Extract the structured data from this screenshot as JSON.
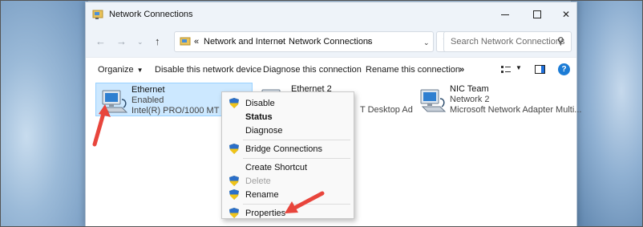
{
  "window": {
    "title": "Network Connections"
  },
  "address": {
    "prefix": "«",
    "crumbs": [
      "Network and Internet",
      "Network Connections"
    ]
  },
  "search": {
    "placeholder": "Search Network Connections"
  },
  "toolbar": {
    "organize": "Organize",
    "disable": "Disable this network device",
    "diagnose": "Diagnose this connection",
    "rename": "Rename this connection",
    "more": "»"
  },
  "connections": [
    {
      "name": "Ethernet",
      "status": "Enabled",
      "adapter": "Intel(R) PRO/1000 MT Deskt"
    },
    {
      "name": "Ethernet 2",
      "status": "",
      "adapter": "T Desktop Ad"
    },
    {
      "name": "NIC Team",
      "status": "Network 2",
      "adapter": "Microsoft Network Adapter Multi..."
    }
  ],
  "context_menu": {
    "items": [
      {
        "label": "Disable",
        "shield": true,
        "bold": false,
        "disabled": false
      },
      {
        "label": "Status",
        "shield": false,
        "bold": true,
        "disabled": false
      },
      {
        "label": "Diagnose",
        "shield": false,
        "bold": false,
        "disabled": false
      },
      {
        "label": "Bridge Connections",
        "shield": true,
        "bold": false,
        "disabled": false
      },
      {
        "label": "Create Shortcut",
        "shield": false,
        "bold": false,
        "disabled": false
      },
      {
        "label": "Delete",
        "shield": true,
        "bold": false,
        "disabled": true
      },
      {
        "label": "Rename",
        "shield": true,
        "bold": false,
        "disabled": false
      },
      {
        "label": "Properties",
        "shield": true,
        "bold": false,
        "disabled": false
      }
    ]
  },
  "colors": {
    "selection": "#cce8ff",
    "annotation_arrow": "#e8453c",
    "accent": "#1c7cd6"
  }
}
